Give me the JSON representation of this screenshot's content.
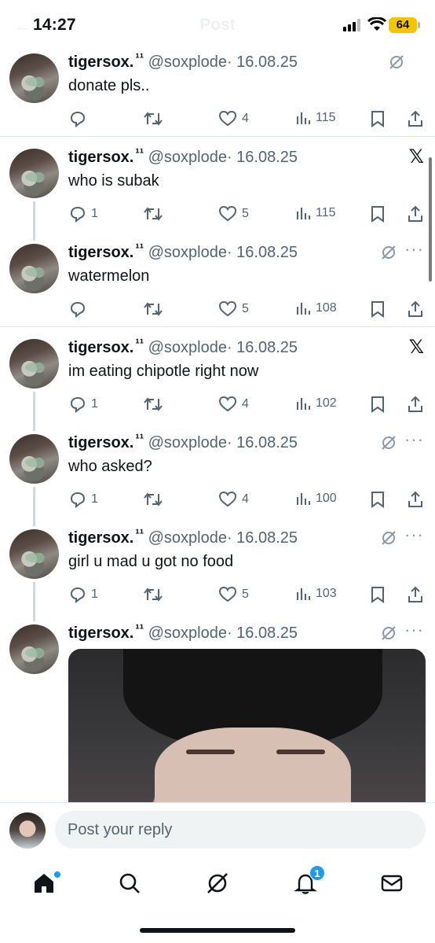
{
  "status_bar": {
    "time": "14:27",
    "battery": "64",
    "ghost_title": "Post"
  },
  "tweets": [
    {
      "name": "tigersox.",
      "badge": "¹¹",
      "handle": "@soxplode",
      "date": "· 16.08.25",
      "text": "donate pls..",
      "replies": "",
      "likes": "4",
      "views": "115",
      "corner": "grok"
    },
    {
      "name": "tigersox.",
      "badge": "¹¹",
      "handle": "@soxplode",
      "date": "· 16.08.25",
      "text": "who is subak",
      "replies": "1",
      "likes": "5",
      "views": "115",
      "corner": "x"
    },
    {
      "name": "tigersox.",
      "badge": "¹¹",
      "handle": "@soxplode",
      "date": "· 16.08.25",
      "text": "watermelon",
      "replies": "",
      "likes": "5",
      "views": "108",
      "corner": "grok-more"
    },
    {
      "name": "tigersox.",
      "badge": "¹¹",
      "handle": "@soxplode",
      "date": "· 16.08.25",
      "text": "im eating chipotle right now",
      "replies": "1",
      "likes": "4",
      "views": "102",
      "corner": "x"
    },
    {
      "name": "tigersox.",
      "badge": "¹¹",
      "handle": "@soxplode",
      "date": "· 16.08.25",
      "text": "who asked?",
      "replies": "1",
      "likes": "4",
      "views": "100",
      "corner": "grok-more"
    },
    {
      "name": "tigersox.",
      "badge": "¹¹",
      "handle": "@soxplode",
      "date": "· 16.08.25",
      "text": "girl u mad u got no food",
      "replies": "1",
      "likes": "5",
      "views": "103",
      "corner": "grok-more"
    },
    {
      "name": "tigersox.",
      "badge": "¹¹",
      "handle": "@soxplode",
      "date": "· 16.08.25",
      "text": "",
      "corner": "grok-more"
    }
  ],
  "reply_bar": {
    "placeholder": "Post your reply"
  },
  "tab_bar": {
    "notification_count": "1"
  },
  "icons": [
    "reply-icon",
    "retweet-icon",
    "heart-icon",
    "views-icon",
    "bookmark-icon",
    "share-icon",
    "grok-icon",
    "x-logo-icon",
    "more-icon",
    "home-icon",
    "search-icon",
    "notifications-icon",
    "messages-icon"
  ],
  "colors": {
    "accent": "#1d9bf0",
    "secondary_text": "#536471",
    "battery": "#f2c500"
  }
}
